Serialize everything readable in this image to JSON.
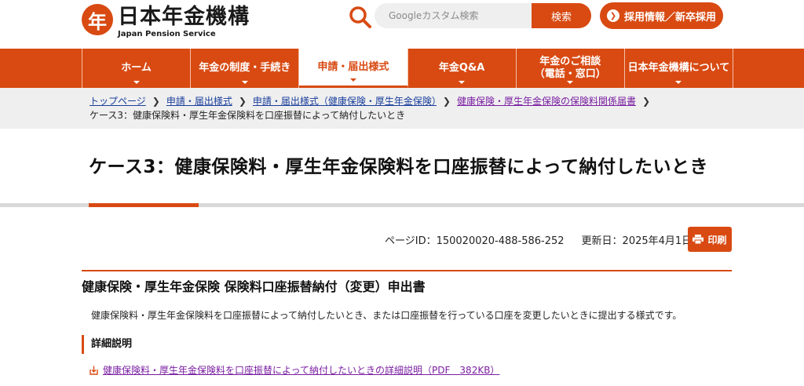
{
  "header": {
    "logo_mark": "年",
    "logo_jp": "日本年金機構",
    "logo_en": "Japan Pension Service",
    "search_placeholder": "Googleカスタム検索",
    "search_button": "検索",
    "recruit_button": "採用情報／新卒採用"
  },
  "nav": {
    "items": [
      {
        "label": "ホーム"
      },
      {
        "label": "年金の制度・手続き"
      },
      {
        "label": "申請・届出様式"
      },
      {
        "label": "年金Q&A"
      },
      {
        "label": "年金のご相談\n（電話・窓口）"
      },
      {
        "label": "日本年金機構について"
      }
    ]
  },
  "breadcrumb": {
    "items": [
      "トップページ",
      "申請・届出様式",
      "申請・届出様式（健康保険・厚生年金保険）",
      "健康保険・厚生年金保険の保険料関係届書"
    ],
    "current": "ケース3：健康保険料・厚生年金保険料を口座振替によって納付したいとき"
  },
  "page": {
    "title": "ケース3：健康保険料・厚生年金保険料を口座振替によって納付したいとき",
    "page_id": "ページID：150020020-488-586-252",
    "updated": "更新日：2025年4月1日",
    "print_label": "印刷"
  },
  "section": {
    "title": "健康保険・厚生年金保険 保険料口座振替納付（変更）申出書",
    "description": "健康保険料・厚生年金保険料を口座振替によって納付したいとき、または口座振替を行っている口座を変更したいときに提出する様式です。",
    "detail_heading": "詳細説明",
    "pdf_link": "健康保険料・厚生年金保険料を口座振替によって納付したいときの詳細説明（PDF　382KB）"
  },
  "colors": {
    "accent": "#d84a12",
    "link": "#1a3f9c",
    "visited": "#7a1fa2"
  },
  "icons": [
    "logo-icon",
    "search-icon",
    "chevron-right-icon",
    "print-icon",
    "pdf-icon"
  ]
}
